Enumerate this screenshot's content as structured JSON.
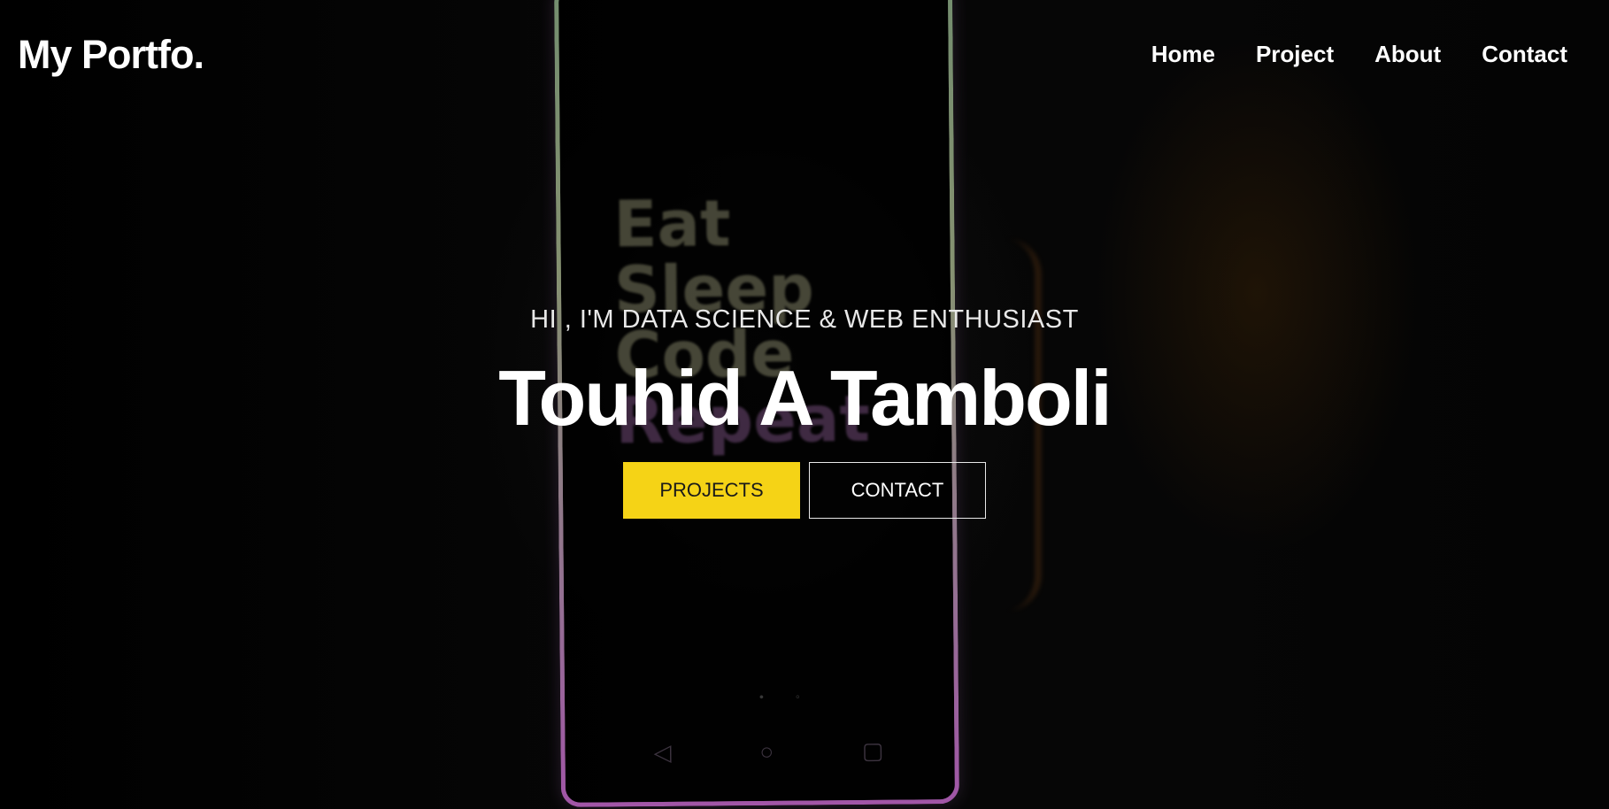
{
  "navbar": {
    "logo": "My Portfo.",
    "links": [
      "Home",
      "Project",
      "About",
      "Contact"
    ]
  },
  "hero": {
    "subtitle": "HI , I'M DATA SCIENCE & WEB ENTHUSIAST",
    "name": "Touhid A Tamboli",
    "buttons": {
      "projects": "PROJECTS",
      "contact": "CONTACT"
    },
    "background_text": [
      "Eat",
      "Sleep",
      "Code",
      "Repeat"
    ]
  },
  "colors": {
    "accent": "#f5d316",
    "background": "#000000",
    "text": "#ffffff"
  }
}
